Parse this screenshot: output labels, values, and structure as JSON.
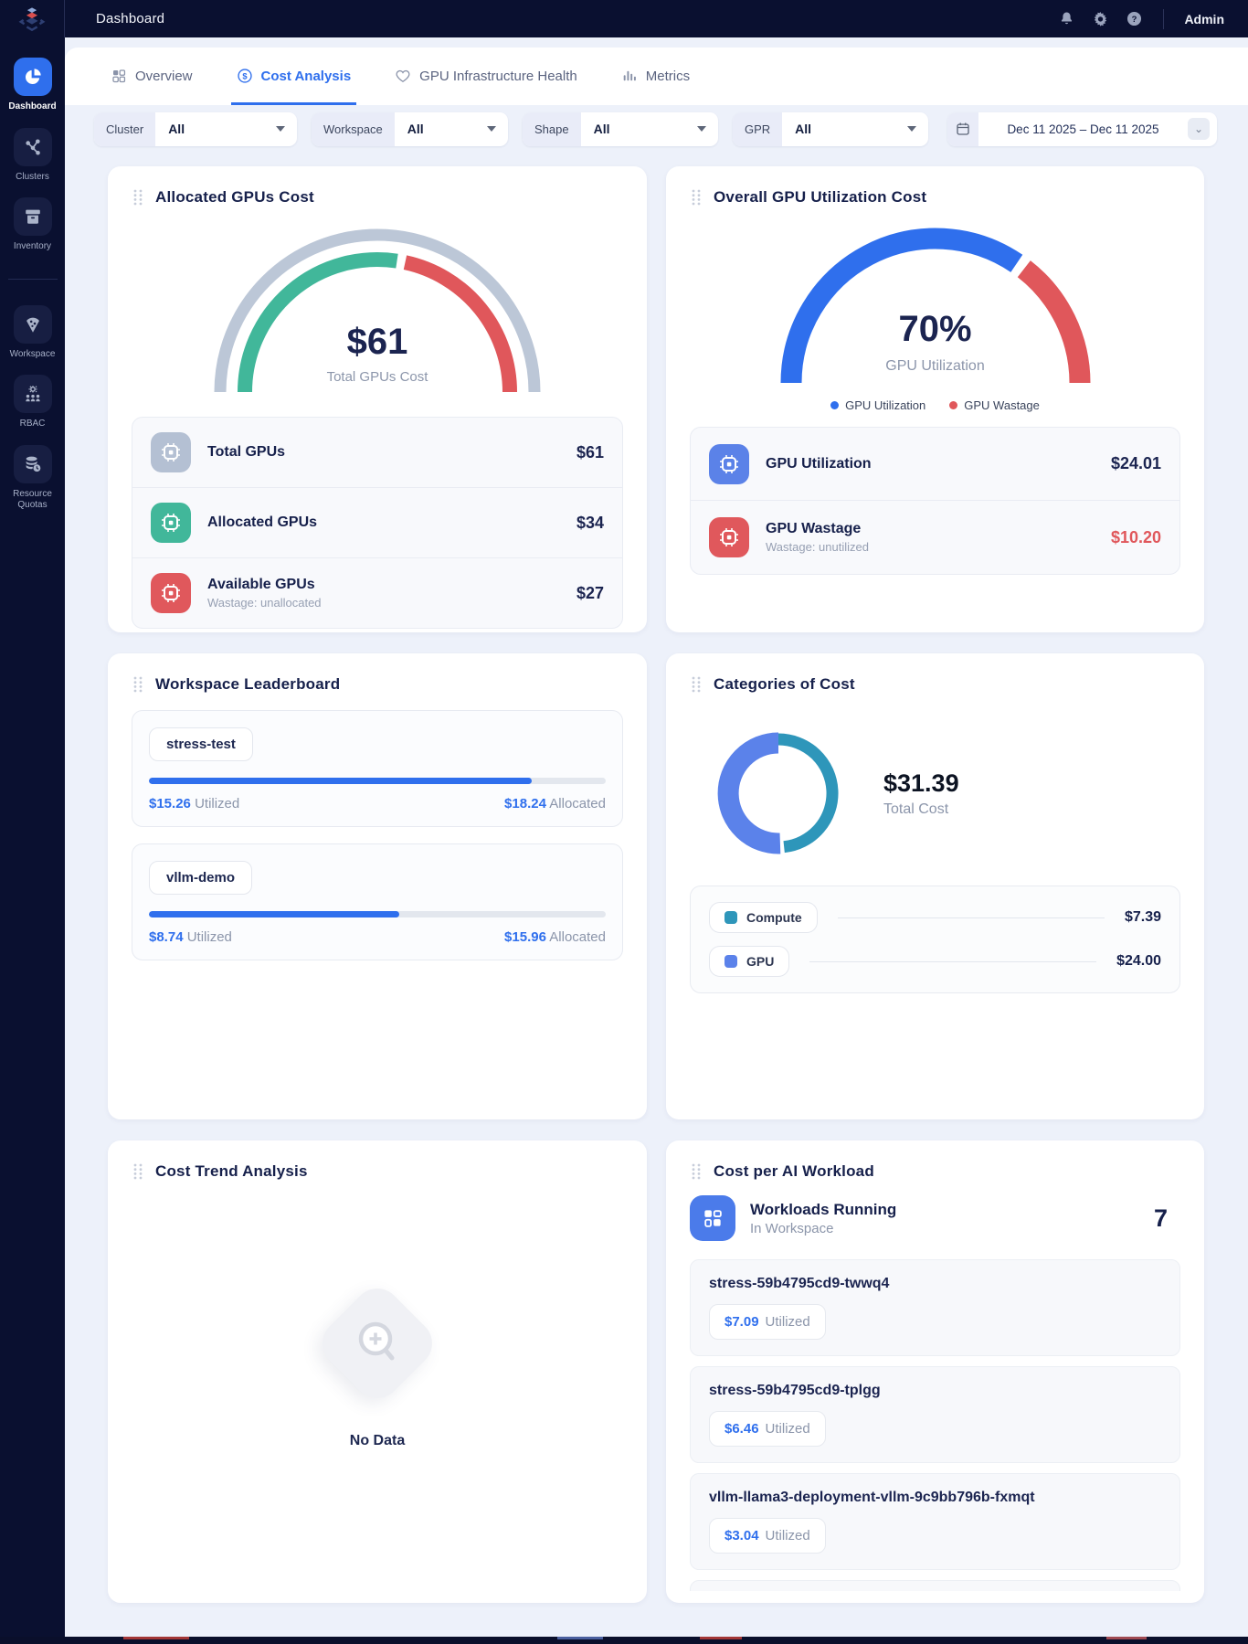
{
  "colors": {
    "accent_blue": "#2f6fed",
    "green": "#41b79a",
    "red": "#e0575b",
    "gauge_track": "#bcc7d7",
    "donut_blue": "#5b82ea",
    "donut_teal": "#2e96ba",
    "navy": "#0a1030"
  },
  "topbar": {
    "title": "Dashboard",
    "user": "Admin"
  },
  "sidebar": {
    "items": [
      {
        "label": "Dashboard"
      },
      {
        "label": "Clusters"
      },
      {
        "label": "Inventory"
      },
      {
        "label": "Workspace"
      },
      {
        "label": "RBAC"
      },
      {
        "label": "Resource Quotas"
      }
    ]
  },
  "tabs": [
    {
      "label": "Overview"
    },
    {
      "label": "Cost Analysis"
    },
    {
      "label": "GPU Infrastructure Health"
    },
    {
      "label": "Metrics"
    }
  ],
  "filters": [
    {
      "label": "Cluster",
      "value": "All"
    },
    {
      "label": "Workspace",
      "value": "All"
    },
    {
      "label": "Shape",
      "value": "All"
    },
    {
      "label": "GPR",
      "value": "All"
    }
  ],
  "date_picker": {
    "range": "Dec 11 2025 – Dec 11 2025",
    "chevron": "⌄"
  },
  "allocated_card": {
    "title": "Allocated GPUs Cost",
    "center_value": "$61",
    "center_label": "Total GPUs Cost",
    "rows": [
      {
        "label": "Total GPUs",
        "value": "$61"
      },
      {
        "label": "Allocated GPUs",
        "value": "$34"
      },
      {
        "label": "Available GPUs",
        "sub": "Wastage: unallocated",
        "value": "$27"
      }
    ]
  },
  "utilization_card": {
    "title": "Overall GPU Utilization Cost",
    "center_value": "70%",
    "center_label": "GPU Utilization",
    "legend": [
      {
        "label": "GPU Utilization"
      },
      {
        "label": "GPU Wastage"
      }
    ],
    "rows": [
      {
        "label": "GPU Utilization",
        "value": "$24.01"
      },
      {
        "label": "GPU Wastage",
        "sub": "Wastage: unutilized",
        "value": "$10.20"
      }
    ]
  },
  "leaderboard_card": {
    "title": "Workspace Leaderboard",
    "rows": [
      {
        "name": "stress-test",
        "utilized_label": "$15.26",
        "utilized_suffix": "Utilized",
        "allocated_label": "$18.24",
        "allocated_suffix": "Allocated"
      },
      {
        "name": "vllm-demo",
        "utilized_label": "$8.74",
        "utilized_suffix": "Utilized",
        "allocated_label": "$15.96",
        "allocated_suffix": "Allocated"
      }
    ]
  },
  "categories_card": {
    "title": "Categories of Cost",
    "total_value": "$31.39",
    "total_label": "Total Cost",
    "legend": [
      {
        "label": "Compute",
        "value": "$7.39"
      },
      {
        "label": "GPU",
        "value": "$24.00"
      }
    ]
  },
  "trend_card": {
    "title": "Cost Trend Analysis",
    "empty_label": "No Data"
  },
  "workloads_card": {
    "title": "Cost per AI Workload",
    "header": {
      "title": "Workloads Running",
      "subtitle": "In Workspace",
      "count": "7"
    },
    "items": [
      {
        "name": "stress-59b4795cd9-twwq4",
        "value": "$7.09",
        "suffix": "Utilized"
      },
      {
        "name": "stress-59b4795cd9-tplgg",
        "value": "$6.46",
        "suffix": "Utilized"
      },
      {
        "name": "vllm-llama3-deployment-vllm-9c9bb796b-fxmqt",
        "value": "$3.04",
        "suffix": "Utilized"
      }
    ]
  },
  "chart_data": [
    {
      "type": "pie",
      "variant": "half_gauge",
      "title": "Allocated GPUs Cost",
      "center_value": "$61",
      "center_label": "Total GPUs Cost",
      "total": 61,
      "slices": [
        {
          "name": "Allocated GPUs",
          "value": 34,
          "color": "#41b79a"
        },
        {
          "name": "Available GPUs",
          "value": 27,
          "color": "#e0575b"
        }
      ],
      "track_color": "#bcc7d7",
      "legend_shown": false
    },
    {
      "type": "pie",
      "variant": "half_gauge",
      "title": "Overall GPU Utilization Cost",
      "center_value": "70%",
      "center_label": "GPU Utilization",
      "total": 100,
      "slices": [
        {
          "name": "GPU Utilization",
          "value": 70,
          "color": "#2f6fed"
        },
        {
          "name": "GPU Wastage",
          "value": 30,
          "color": "#e0575b"
        }
      ],
      "legend_shown": true
    },
    {
      "type": "bar",
      "variant": "horizontal_progress",
      "title": "Workspace Leaderboard",
      "categories": [
        "stress-test",
        "vllm-demo"
      ],
      "series": [
        {
          "name": "Utilized",
          "values": [
            15.26,
            8.74
          ]
        },
        {
          "name": "Allocated",
          "values": [
            18.24,
            15.96
          ]
        }
      ],
      "bar_color": "#2f6fed",
      "track_color": "#e3e7ee"
    },
    {
      "type": "pie",
      "variant": "donut",
      "title": "Categories of Cost",
      "center_value": "$31.39",
      "center_label": "Total Cost",
      "total": 31.39,
      "slices": [
        {
          "name": "GPU",
          "value": 24.0,
          "color": "#5b82ea"
        },
        {
          "name": "Compute",
          "value": 7.39,
          "color": "#2e96ba"
        }
      ],
      "legend_position": "below"
    }
  ]
}
